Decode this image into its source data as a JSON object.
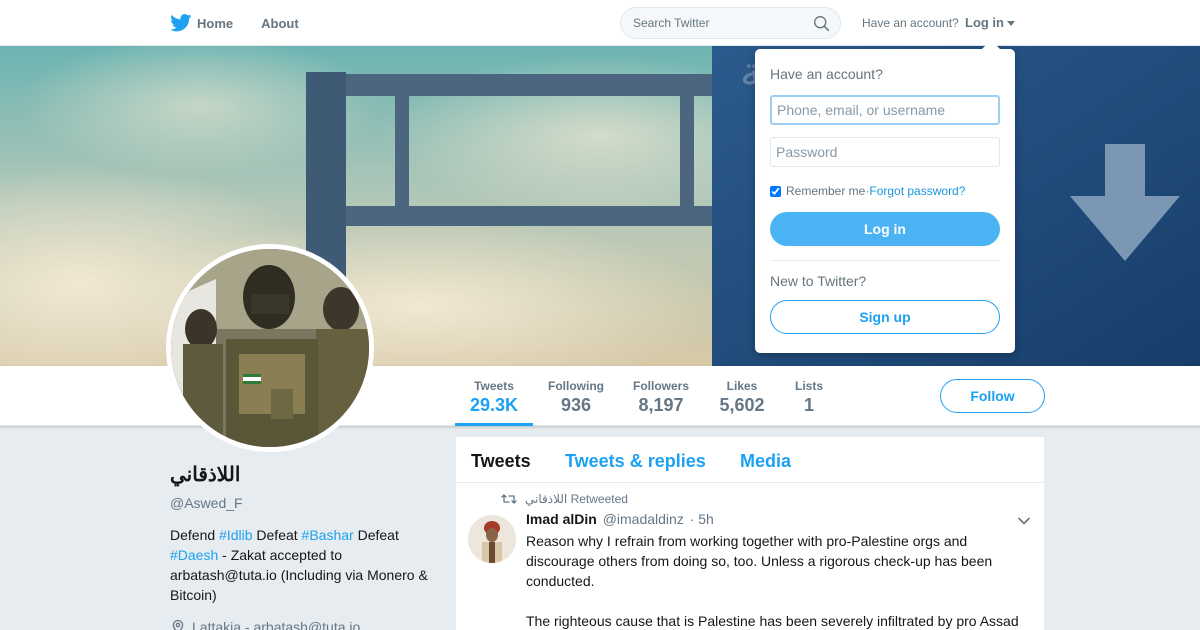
{
  "nav": {
    "home_label": "Home",
    "about_label": "About",
    "search_placeholder": "Search Twitter",
    "account_prompt": "Have an account?",
    "login_label": "Log in"
  },
  "profile": {
    "name": "اللاذقاني",
    "handle": "@Aswed_F",
    "bio_parts": [
      "Defend ",
      "#Idlib",
      " Defeat ",
      "#Bashar",
      " Defeat ",
      "#Daesh",
      " - Zakat accepted to arbatash@tuta.io (Including via Monero & Bitcoin)"
    ],
    "location": "Lattakia - arbatash@tuta.io"
  },
  "stats": [
    {
      "label": "Tweets",
      "value": "29.3K"
    },
    {
      "label": "Following",
      "value": "936"
    },
    {
      "label": "Followers",
      "value": "8,197"
    },
    {
      "label": "Likes",
      "value": "5,602"
    },
    {
      "label": "Lists",
      "value": "1"
    }
  ],
  "follow_label": "Follow",
  "timeline": {
    "tabs": [
      "Tweets",
      "Tweets & replies",
      "Media"
    ],
    "tweet": {
      "retweeted_by": "اللاذقاني",
      "retweeted_label": "Retweeted",
      "author": "Imad alDin",
      "handle": "@imadaldinz",
      "time": "· 5h",
      "paragraphs": [
        "Reason why I refrain from working together with pro-Palestine orgs and discourage others from doing so, too. Unless a rigorous check-up has been conducted.",
        "The righteous cause that is Palestine has been severely infiltrated by pro Assad"
      ]
    }
  },
  "login_dropdown": {
    "title": "Have an account?",
    "username_placeholder": "Phone, email, or username",
    "password_placeholder": "Password",
    "remember_label": "Remember me",
    "separator": " · ",
    "forgot_label": "Forgot password?",
    "login_button": "Log in",
    "new_prompt": "New to Twitter?",
    "signup_button": "Sign up"
  },
  "colors": {
    "accent": "#1da1f2",
    "login_button_bg": "#4ab3f4",
    "page_bg": "#e6ecf0"
  }
}
